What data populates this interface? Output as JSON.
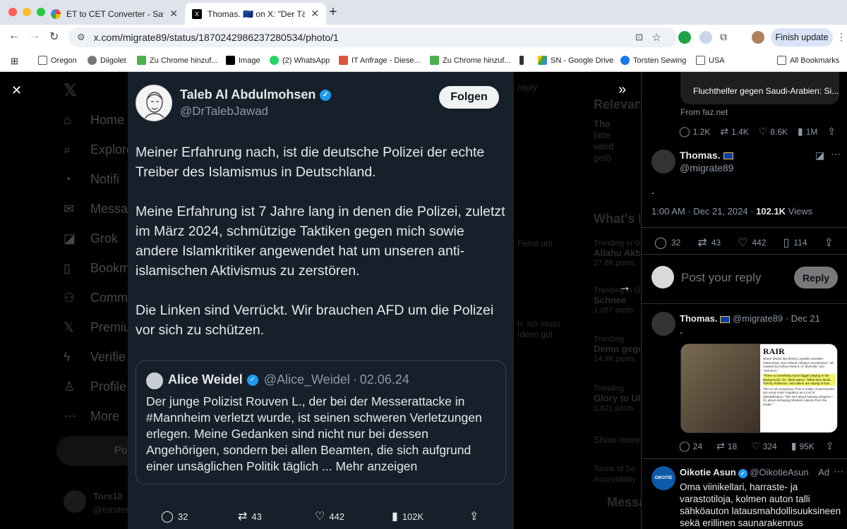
{
  "browser": {
    "tabs": [
      {
        "title": "ET to CET Converter - Savvy",
        "active": false
      },
      {
        "title": "Thomas. 🇪🇺 on X: \"Der Täter",
        "active": true
      }
    ],
    "url": "x.com/migrate89/status/1870242986237280534/photo/1",
    "finish_update": "Finish update",
    "bookmarks": [
      "Oregon",
      "Diigolet",
      "Zu Chrome hinzuf...",
      "Image",
      "(2) WhatsApp",
      "IT Anfrage - Diese...",
      "Zu Chrome hinzuf...",
      "",
      "SN - Google Drive",
      "Torsten Sewing",
      "USA",
      "All Bookmarks"
    ]
  },
  "background_nav": [
    "Home",
    "Explore",
    "Notifi",
    "Messag",
    "Grok",
    "Bookm",
    "Comm",
    "Premiu",
    "Verifie",
    "Profile",
    "More"
  ],
  "background_misc": {
    "post_button": "Po",
    "user_name": "Tors10",
    "user_handle": "@torstensewing",
    "relevant": "Relevan",
    "whats_happening": "What's h",
    "show_more": "Show more",
    "terms": "Terms of Se",
    "accessibility": "Accessibility",
    "messages": "Messa",
    "trends": [
      {
        "context": "Trending in G",
        "title": "Allahu Akb",
        "count": "27.8K posts"
      },
      {
        "context": "Trending in G",
        "title": "Schnee",
        "count": "1,087 posts"
      },
      {
        "context": "Trending",
        "title": "Demo gege",
        "count": "14.9K posts"
      },
      {
        "context": "Trending",
        "title": "Glory to Uk",
        "count": "1,821 posts"
      }
    ],
    "fragments": [
      "Feind um",
      "ly",
      "h. Ich muss",
      "Ideen gut",
      "reply",
      "Tho",
      "bitte",
      "werd",
      "gelö"
    ]
  },
  "tweet": {
    "author": "Taleb Al Abdulmohsen",
    "handle": "@DrTalebJawad",
    "follow": "Folgen",
    "paragraphs": [
      "Meiner Erfahrung nach, ist die deutsche Polizei der echte Treiber des Islamismus in Deutschland.",
      "Meine Erfahrung ist 7 Jahre lang in denen die Polizei, zuletzt im März 2024, schmützige Taktiken gegen mich sowie andere Islamkritiker angewendet hat um unseren anti-islamischen Aktivismus zu zerstören.",
      "Die Linken sind Verrückt. Wir brauchen AFD um die Polizei vor sich zu schützen."
    ],
    "quote": {
      "author": "Alice Weidel",
      "handle": "@Alice_Weidel",
      "date": "02.06.24",
      "text": "Der junge Polizist Rouven L., der bei der Messerattacke in #Mannheim verletzt wurde, ist seinen schweren Verletzungen erlegen. Meine Gedanken sind nicht nur bei dessen Angehörigen, sondern bei allen Beamten, die sich aufgrund einer unsäglichen Politik täglich ...",
      "more": "Mehr anzeigen"
    },
    "actions": {
      "replies": "32",
      "reposts": "43",
      "likes": "442",
      "views": "102K"
    }
  },
  "right": {
    "link_card_title": "Fluchthelfer gegen Saudi-Arabien: Si...",
    "from_site": "From faz.net",
    "prev_stats": {
      "replies": "1.2K",
      "reposts": "1.4K",
      "likes": "8.6K",
      "views": "1M"
    },
    "main_author": {
      "name": "Thomas.",
      "handle": "@migrate89"
    },
    "main_text": ".",
    "timestamp": "1:00 AM · Dec 21, 2024 · ",
    "views_count": "102.1K",
    "views_label": " Views",
    "stats": {
      "replies": "32",
      "reposts": "43",
      "likes": "442",
      "bookmarks": "114"
    },
    "reply_placeholder": "Post your reply",
    "reply_button": "Reply",
    "reply_author": {
      "name": "Thomas.",
      "handle": "@migrate89",
      "date": "Dec 21"
    },
    "reply_text": ".",
    "reply_stats": {
      "replies": "24",
      "reposts": "18",
      "likes": "324",
      "views": "95K"
    },
    "thumb_text": {
      "logo": "RAIR",
      "para1": "where Sharia law thrives, parallel societies entrenched, and cultural collapse accelerated—all masked by hollow rhetoric of \"diversity\" and \"inclusion.\"",
      "highlight": "\"There is something much bigger playing in the background,\" Dr. Taleb warns. \"What Elon Musk, Tommy Robinson, and others are saying is true.",
      "para2": "This is not conspiracy. This is reality. Governments are using mass migration as a tool of destabilization. This isn't about helping refugees—it's about reshaping Western nations from the inside.\""
    },
    "ad": {
      "name": "Oikotie Asun",
      "handle": "@OikotieAsun",
      "label": "Ad",
      "logo": "OIKOTIE",
      "text": "Oma viinikellari, harraste- ja varastotiloja, kolmen auton talli sähköauton latausmahdollisuuksineen sekä erillinen saunarakennus"
    }
  },
  "colors": {
    "accent": "#1d9bf0",
    "card_bg": "#16202b",
    "text": "#e7e9ea",
    "muted": "#8b98a5"
  }
}
